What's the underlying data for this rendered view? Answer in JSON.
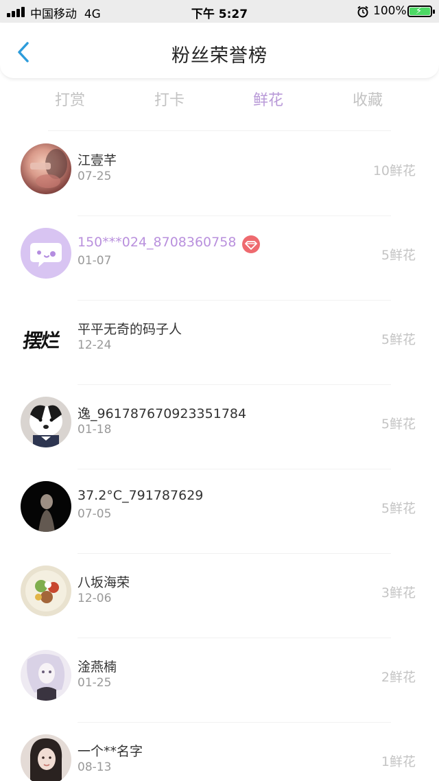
{
  "status_bar": {
    "carrier": "中国移动",
    "network": "4G",
    "time": "下午 5:27",
    "battery_percent": "100%"
  },
  "nav": {
    "title": "粉丝荣誉榜",
    "back_icon": "chevron-left-icon"
  },
  "tabs": [
    {
      "label": "打赏",
      "active": false
    },
    {
      "label": "打卡",
      "active": false
    },
    {
      "label": "鲜花",
      "active": true
    },
    {
      "label": "收藏",
      "active": false
    }
  ],
  "colors": {
    "accent": "#b99ad8",
    "back_arrow": "#2d9cdb",
    "badge": "#ee6a6f",
    "vip_name": "#b990dd"
  },
  "fans": [
    {
      "name": "江壹芊",
      "date": "07-25",
      "count": "10鲜花",
      "avatar": "photo-avatar",
      "highlight": false
    },
    {
      "name": "150***024_8708360758",
      "date": "01-07",
      "count": "5鲜花",
      "avatar": "chat-bubble-avatar",
      "highlight": true,
      "badge": "diamond-icon"
    },
    {
      "name": "平平无奇的码子人",
      "date": "12-24",
      "count": "5鲜花",
      "avatar": "calligraphy-avatar",
      "highlight": false
    },
    {
      "name": "逸_961787670923351784",
      "date": "01-18",
      "count": "5鲜花",
      "avatar": "dog-photo-avatar",
      "highlight": false
    },
    {
      "name": "37.2°C_791787629",
      "date": "07-05",
      "count": "5鲜花",
      "avatar": "dark-photo-avatar",
      "highlight": false
    },
    {
      "name": "八坂海荣",
      "date": "12-06",
      "count": "3鲜花",
      "avatar": "food-photo-avatar",
      "highlight": false
    },
    {
      "name": "淦燕楠",
      "date": "01-25",
      "count": "2鲜花",
      "avatar": "anime-photo-avatar",
      "highlight": false
    },
    {
      "name": "一个**名字",
      "date": "08-13",
      "count": "1鲜花",
      "avatar": "girl-photo-avatar",
      "highlight": false
    }
  ],
  "avatar_text": {
    "calligraphy": "摆烂"
  }
}
